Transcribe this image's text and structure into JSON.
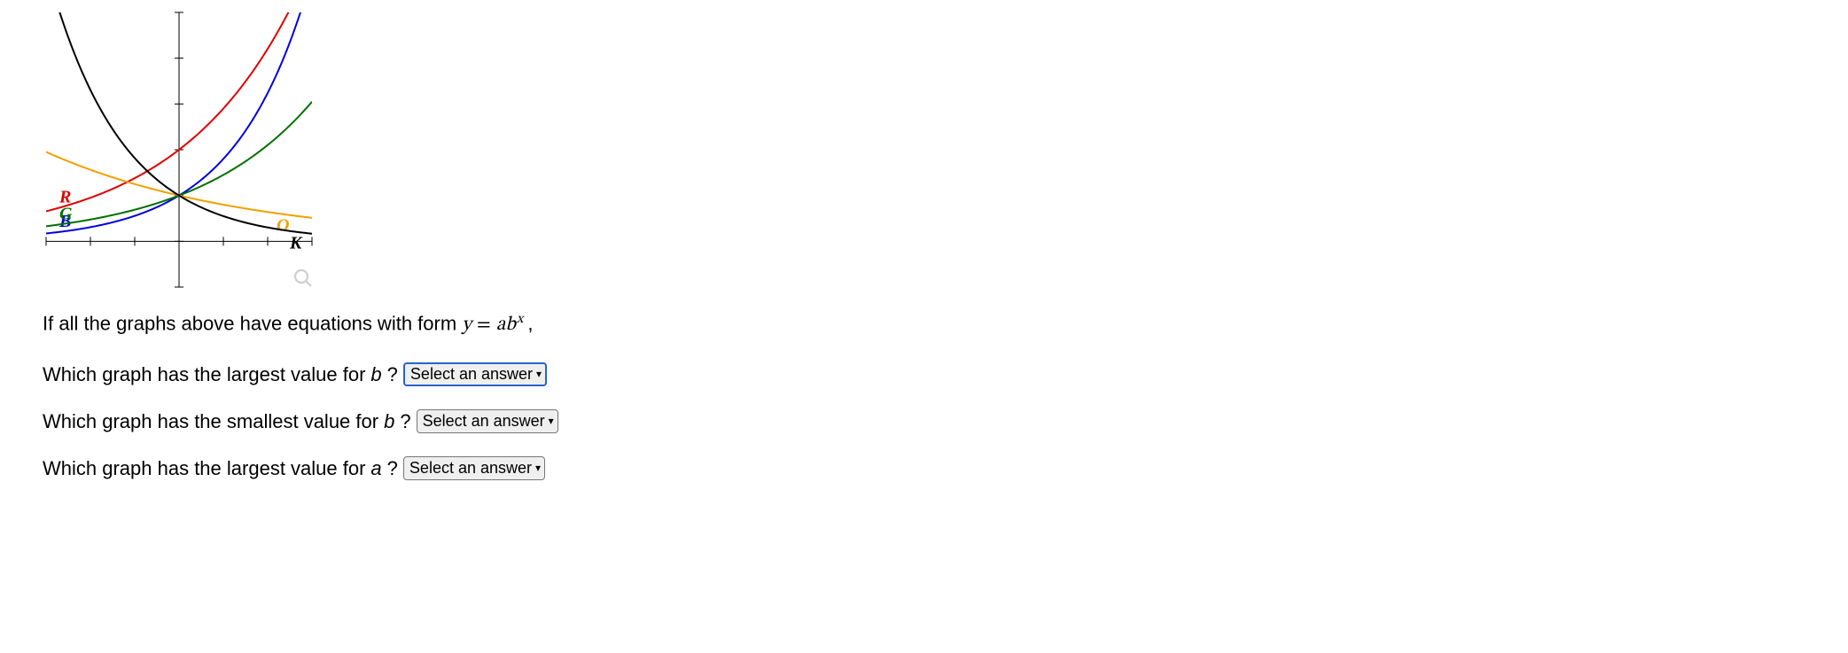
{
  "prompt_prefix": "If all the graphs above have equations with form ",
  "equation": {
    "lhs": "y",
    "eq": "=",
    "a": "a",
    "b": "b",
    "exp": "x",
    "suffix": ","
  },
  "questions": [
    {
      "text_pre": "Which graph has the largest value for ",
      "var": "b",
      "text_post": "?",
      "select_placeholder": "Select an answer",
      "focused": true
    },
    {
      "text_pre": "Which graph has the smallest value for ",
      "var": "b",
      "text_post": "?",
      "select_placeholder": "Select an answer",
      "focused": false
    },
    {
      "text_pre": "Which graph has the largest value for ",
      "var": "a",
      "text_post": "?",
      "select_placeholder": "Select an answer",
      "focused": false
    }
  ],
  "chart_data": {
    "type": "line",
    "title": "",
    "xlabel": "",
    "ylabel": "",
    "xlim": [
      -3,
      3
    ],
    "ylim": [
      -1,
      5
    ],
    "x_ticks": [
      -3,
      -2,
      -1,
      0,
      1,
      2,
      3
    ],
    "y_ticks": [
      -1,
      0,
      1,
      2,
      3,
      4,
      5
    ],
    "grid": false,
    "axes": true,
    "series": [
      {
        "name": "R",
        "label": "R",
        "color": "#e00000",
        "a": 2.0,
        "b": 1.45,
        "label_at_x": -2.7,
        "samples_x": [
          -3,
          -2.5,
          -2,
          -1.5,
          -1,
          -0.5,
          0,
          0.5,
          1,
          1.5,
          2,
          2.5,
          3
        ],
        "samples_y": [
          0.657,
          0.79,
          0.951,
          1.145,
          1.379,
          1.661,
          2.0,
          2.408,
          2.9,
          3.492,
          4.205,
          5.063,
          6.097
        ]
      },
      {
        "name": "B",
        "label": "B",
        "color": "#0000e0",
        "a": 1.0,
        "b": 1.8,
        "label_at_x": -2.7,
        "samples_x": [
          -3,
          -2.5,
          -2,
          -1.5,
          -1,
          -0.5,
          0,
          0.5,
          1,
          1.5,
          2,
          2.5,
          3
        ],
        "samples_y": [
          0.171,
          0.23,
          0.309,
          0.414,
          0.556,
          0.745,
          1.0,
          1.342,
          1.8,
          2.415,
          3.24,
          4.347,
          5.832
        ]
      },
      {
        "name": "G",
        "label": "G",
        "color": "#007000",
        "a": 1.0,
        "b": 1.45,
        "label_at_x": -2.7,
        "samples_x": [
          -3,
          -2.5,
          -2,
          -1.5,
          -1,
          -0.5,
          0,
          0.5,
          1,
          1.5,
          2,
          2.5,
          3
        ],
        "samples_y": [
          0.328,
          0.395,
          0.476,
          0.573,
          0.69,
          0.83,
          1.0,
          1.204,
          1.45,
          1.746,
          2.103,
          2.532,
          3.049
        ]
      },
      {
        "name": "O",
        "label": "O",
        "color": "#f0a000",
        "a": 1.0,
        "b": 0.8,
        "label_at_x": 2.2,
        "samples_x": [
          -3,
          -2.5,
          -2,
          -1.5,
          -1,
          -0.5,
          0,
          0.5,
          1,
          1.5,
          2,
          2.5,
          3
        ],
        "samples_y": [
          1.953,
          1.747,
          1.563,
          1.398,
          1.25,
          1.118,
          1.0,
          0.894,
          0.8,
          0.716,
          0.64,
          0.572,
          0.512
        ]
      },
      {
        "name": "K",
        "label": "K",
        "color": "#000000",
        "a": 1.0,
        "b": 0.55,
        "label_at_x": 2.5,
        "samples_x": [
          -3,
          -2.5,
          -2,
          -1.5,
          -1,
          -0.5,
          0,
          0.5,
          1,
          1.5,
          2,
          2.5,
          3
        ],
        "samples_y": [
          6.011,
          4.458,
          3.306,
          2.452,
          1.818,
          1.348,
          1.0,
          0.742,
          0.55,
          0.408,
          0.303,
          0.224,
          0.166
        ]
      }
    ]
  }
}
